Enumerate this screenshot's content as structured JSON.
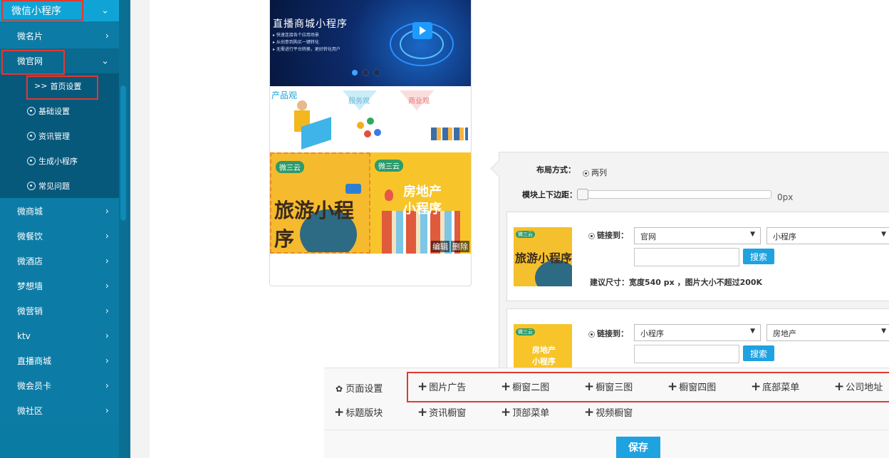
{
  "sidebar": {
    "top": "微信小程序",
    "items": [
      {
        "label": "微名片"
      },
      {
        "label": "微官网"
      },
      {
        "label": "微商城"
      },
      {
        "label": "微餐饮"
      },
      {
        "label": "微酒店"
      },
      {
        "label": "梦想墙"
      },
      {
        "label": "微营销"
      },
      {
        "label": "ktv"
      },
      {
        "label": "直播商城"
      },
      {
        "label": "微会员卡"
      },
      {
        "label": "微社区"
      }
    ],
    "sub": [
      {
        "label": "首页设置",
        "prefix": ">>"
      },
      {
        "label": "基础设置"
      },
      {
        "label": "资讯管理"
      },
      {
        "label": "生成小程序"
      },
      {
        "label": "常见问题"
      }
    ]
  },
  "phone": {
    "banner_title": "直播商城小程序",
    "banner_lines": [
      "快速连接各个应用场景",
      "从创意到购买一键转化",
      "无需进行平台转换，更好转化用户"
    ],
    "cards": [
      "产品观",
      "服务观",
      "商业观"
    ],
    "tile_left": {
      "logo": "微三云",
      "text": "旅游小程序"
    },
    "tile_right": {
      "logo": "微三云",
      "text": "房地产小程序"
    },
    "tile_actions": [
      "编辑",
      "删除"
    ]
  },
  "settings": {
    "layout_label": "布局方式：",
    "layout_value": "两列",
    "margin_label": "模块上下边距：",
    "margin_value": "0px",
    "block1": {
      "link_label": "链接到：",
      "select1": "官网",
      "select2": "小程序",
      "search": "搜索",
      "hint": "建议尺寸：宽度540 px ，图片大小不超过200K"
    },
    "block2": {
      "link_label": "链接到：",
      "select1": "小程序",
      "select2": "房地产",
      "search": "搜索"
    }
  },
  "toolbar": {
    "page_settings": "页面设置",
    "row1": [
      "图片广告",
      "橱窗二图",
      "橱窗三图",
      "橱窗四图",
      "底部菜单",
      "公司地址"
    ],
    "row2": [
      "标题版块",
      "资讯橱窗",
      "顶部菜单",
      "视频橱窗"
    ],
    "save": "保存"
  },
  "colors": {
    "sidebar": "#0a7ba2",
    "sidebar_top": "#10a3d6",
    "accent": "#1fa2e0",
    "highlight": "#e0392f"
  }
}
